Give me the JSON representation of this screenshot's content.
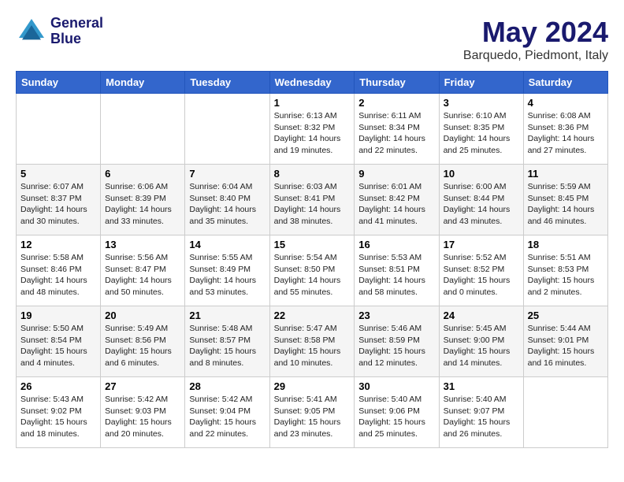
{
  "header": {
    "logo_line1": "General",
    "logo_line2": "Blue",
    "month": "May 2024",
    "location": "Barquedo, Piedmont, Italy"
  },
  "weekdays": [
    "Sunday",
    "Monday",
    "Tuesday",
    "Wednesday",
    "Thursday",
    "Friday",
    "Saturday"
  ],
  "weeks": [
    [
      {
        "day": "",
        "info": ""
      },
      {
        "day": "",
        "info": ""
      },
      {
        "day": "",
        "info": ""
      },
      {
        "day": "1",
        "info": "Sunrise: 6:13 AM\nSunset: 8:32 PM\nDaylight: 14 hours\nand 19 minutes."
      },
      {
        "day": "2",
        "info": "Sunrise: 6:11 AM\nSunset: 8:34 PM\nDaylight: 14 hours\nand 22 minutes."
      },
      {
        "day": "3",
        "info": "Sunrise: 6:10 AM\nSunset: 8:35 PM\nDaylight: 14 hours\nand 25 minutes."
      },
      {
        "day": "4",
        "info": "Sunrise: 6:08 AM\nSunset: 8:36 PM\nDaylight: 14 hours\nand 27 minutes."
      }
    ],
    [
      {
        "day": "5",
        "info": "Sunrise: 6:07 AM\nSunset: 8:37 PM\nDaylight: 14 hours\nand 30 minutes."
      },
      {
        "day": "6",
        "info": "Sunrise: 6:06 AM\nSunset: 8:39 PM\nDaylight: 14 hours\nand 33 minutes."
      },
      {
        "day": "7",
        "info": "Sunrise: 6:04 AM\nSunset: 8:40 PM\nDaylight: 14 hours\nand 35 minutes."
      },
      {
        "day": "8",
        "info": "Sunrise: 6:03 AM\nSunset: 8:41 PM\nDaylight: 14 hours\nand 38 minutes."
      },
      {
        "day": "9",
        "info": "Sunrise: 6:01 AM\nSunset: 8:42 PM\nDaylight: 14 hours\nand 41 minutes."
      },
      {
        "day": "10",
        "info": "Sunrise: 6:00 AM\nSunset: 8:44 PM\nDaylight: 14 hours\nand 43 minutes."
      },
      {
        "day": "11",
        "info": "Sunrise: 5:59 AM\nSunset: 8:45 PM\nDaylight: 14 hours\nand 46 minutes."
      }
    ],
    [
      {
        "day": "12",
        "info": "Sunrise: 5:58 AM\nSunset: 8:46 PM\nDaylight: 14 hours\nand 48 minutes."
      },
      {
        "day": "13",
        "info": "Sunrise: 5:56 AM\nSunset: 8:47 PM\nDaylight: 14 hours\nand 50 minutes."
      },
      {
        "day": "14",
        "info": "Sunrise: 5:55 AM\nSunset: 8:49 PM\nDaylight: 14 hours\nand 53 minutes."
      },
      {
        "day": "15",
        "info": "Sunrise: 5:54 AM\nSunset: 8:50 PM\nDaylight: 14 hours\nand 55 minutes."
      },
      {
        "day": "16",
        "info": "Sunrise: 5:53 AM\nSunset: 8:51 PM\nDaylight: 14 hours\nand 58 minutes."
      },
      {
        "day": "17",
        "info": "Sunrise: 5:52 AM\nSunset: 8:52 PM\nDaylight: 15 hours\nand 0 minutes."
      },
      {
        "day": "18",
        "info": "Sunrise: 5:51 AM\nSunset: 8:53 PM\nDaylight: 15 hours\nand 2 minutes."
      }
    ],
    [
      {
        "day": "19",
        "info": "Sunrise: 5:50 AM\nSunset: 8:54 PM\nDaylight: 15 hours\nand 4 minutes."
      },
      {
        "day": "20",
        "info": "Sunrise: 5:49 AM\nSunset: 8:56 PM\nDaylight: 15 hours\nand 6 minutes."
      },
      {
        "day": "21",
        "info": "Sunrise: 5:48 AM\nSunset: 8:57 PM\nDaylight: 15 hours\nand 8 minutes."
      },
      {
        "day": "22",
        "info": "Sunrise: 5:47 AM\nSunset: 8:58 PM\nDaylight: 15 hours\nand 10 minutes."
      },
      {
        "day": "23",
        "info": "Sunrise: 5:46 AM\nSunset: 8:59 PM\nDaylight: 15 hours\nand 12 minutes."
      },
      {
        "day": "24",
        "info": "Sunrise: 5:45 AM\nSunset: 9:00 PM\nDaylight: 15 hours\nand 14 minutes."
      },
      {
        "day": "25",
        "info": "Sunrise: 5:44 AM\nSunset: 9:01 PM\nDaylight: 15 hours\nand 16 minutes."
      }
    ],
    [
      {
        "day": "26",
        "info": "Sunrise: 5:43 AM\nSunset: 9:02 PM\nDaylight: 15 hours\nand 18 minutes."
      },
      {
        "day": "27",
        "info": "Sunrise: 5:42 AM\nSunset: 9:03 PM\nDaylight: 15 hours\nand 20 minutes."
      },
      {
        "day": "28",
        "info": "Sunrise: 5:42 AM\nSunset: 9:04 PM\nDaylight: 15 hours\nand 22 minutes."
      },
      {
        "day": "29",
        "info": "Sunrise: 5:41 AM\nSunset: 9:05 PM\nDaylight: 15 hours\nand 23 minutes."
      },
      {
        "day": "30",
        "info": "Sunrise: 5:40 AM\nSunset: 9:06 PM\nDaylight: 15 hours\nand 25 minutes."
      },
      {
        "day": "31",
        "info": "Sunrise: 5:40 AM\nSunset: 9:07 PM\nDaylight: 15 hours\nand 26 minutes."
      },
      {
        "day": "",
        "info": ""
      }
    ]
  ]
}
